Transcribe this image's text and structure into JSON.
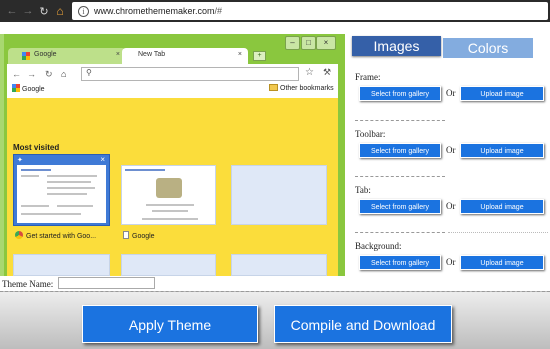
{
  "browser": {
    "back_icon": "arrow-left-icon",
    "forward_icon": "arrow-right-icon",
    "reload_icon": "reload-icon",
    "home_icon": "home-icon",
    "url_host": "www.chromethememaker.com",
    "url_rest": "/#"
  },
  "preview": {
    "tab_google": "Google",
    "tab_newtab": "New Tab",
    "bookmark_google": "Google",
    "bookmark_other": "Other bookmarks",
    "most_visited": "Most visited",
    "thumb1_label": "Get started with Goo...",
    "thumb2_label": "Google",
    "colors": {
      "frame": "#8ac73e",
      "ntp": "#fbdd3b",
      "toolbar": "#ffffff"
    }
  },
  "editor": {
    "tabs": {
      "images": "Images",
      "colors": "Colors"
    },
    "sections": [
      {
        "label": "Frame:",
        "gallery": "Select from gallery",
        "or": "Or",
        "upload": "Upload image"
      },
      {
        "label": "Toolbar:",
        "gallery": "Select from gallery",
        "or": "Or",
        "upload": "Upload image"
      },
      {
        "label": "Tab:",
        "gallery": "Select from gallery",
        "or": "Or",
        "upload": "Upload image"
      },
      {
        "label": "Background:",
        "gallery": "Select from gallery",
        "or": "Or",
        "upload": "Upload image"
      }
    ],
    "accent": "#1b73e0"
  },
  "footer": {
    "theme_name_label": "Theme Name:",
    "theme_name_value": "",
    "apply": "Apply Theme",
    "compile": "Compile and Download"
  }
}
